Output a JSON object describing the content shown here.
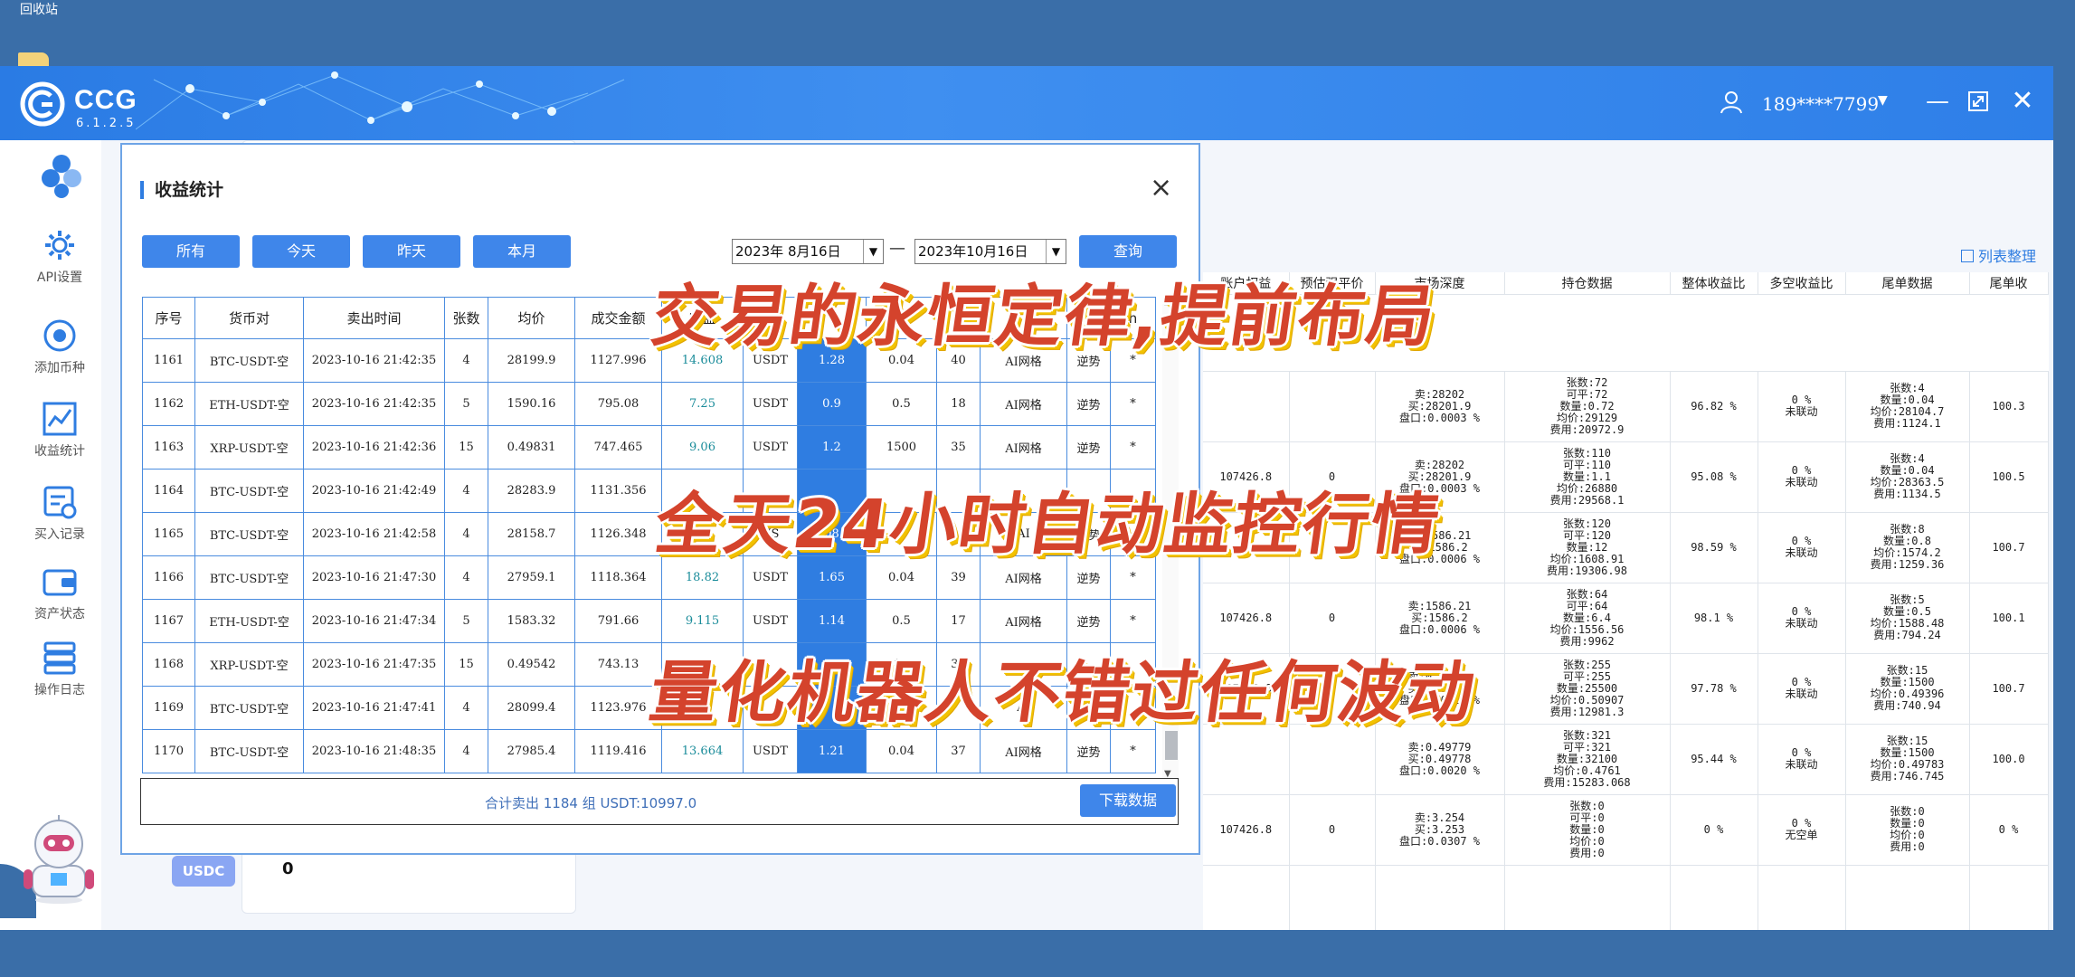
{
  "desktop": {
    "recycle_bin": "回收站"
  },
  "header": {
    "app_name": "CCG",
    "version": "6.1.2.5",
    "user": "189****7799"
  },
  "sidebar": {
    "items": [
      {
        "label": "API设置",
        "icon": "gear-icon"
      },
      {
        "label": "添加币种",
        "icon": "coin-add-icon"
      },
      {
        "label": "收益统计",
        "icon": "chart-icon"
      },
      {
        "label": "买入记录",
        "icon": "record-icon"
      },
      {
        "label": "资产状态",
        "icon": "wallet-icon"
      },
      {
        "label": "操作日志",
        "icon": "log-icon"
      }
    ]
  },
  "background": {
    "usdc_label": "USDC",
    "usdc_value": "0",
    "list_sort": "列表整理",
    "columns": [
      "账户权益",
      "预估强平价",
      "市场深度",
      "持仓数据",
      "整体收益比",
      "多空收益比",
      "尾单数据",
      "尾单收"
    ],
    "rows": [
      {
        "equity": "",
        "liq": "",
        "depth": [
          "卖:28202",
          "买:28201.9",
          "盘口:0.0003 %"
        ],
        "position": [
          "张数:72",
          "可平:72",
          "数量:0.72",
          "均价:29129",
          "费用:20972.9"
        ],
        "overall": "96.82 %",
        "ls": [
          "0 %",
          "未联动"
        ],
        "tail": [
          "张数:4",
          "数量:0.04",
          "均价:28104.7",
          "费用:1124.1"
        ],
        "tail_ret": "100.3"
      },
      {
        "equity": "107426.8",
        "liq": "0",
        "depth": [
          "卖:28202",
          "买:28201.9",
          "盘口:0.0003 %"
        ],
        "position": [
          "张数:110",
          "可平:110",
          "数量:1.1",
          "均价:26880",
          "费用:29568.1"
        ],
        "overall": "95.08 %",
        "ls": [
          "0 %",
          "未联动"
        ],
        "tail": [
          "张数:4",
          "数量:0.04",
          "均价:28363.5",
          "费用:1134.5"
        ],
        "tail_ret": "100.5"
      },
      {
        "equity": "",
        "liq": "",
        "depth": [
          "卖:1586.21",
          "买:1586.2",
          "盘口:0.0006 %"
        ],
        "position": [
          "张数:120",
          "可平:120",
          "数量:12",
          "均价:1608.91",
          "费用:19306.98"
        ],
        "overall": "98.59 %",
        "ls": [
          "0 %",
          "未联动"
        ],
        "tail": [
          "张数:8",
          "数量:0.8",
          "均价:1574.2",
          "费用:1259.36"
        ],
        "tail_ret": "100.7"
      },
      {
        "equity": "107426.8",
        "liq": "0",
        "depth": [
          "卖:1586.21",
          "买:1586.2",
          "盘口:0.0006 %"
        ],
        "position": [
          "张数:64",
          "可平:64",
          "数量:6.4",
          "均价:1556.56",
          "费用:9962"
        ],
        "overall": "98.1 %",
        "ls": [
          "0 %",
          "未联动"
        ],
        "tail": [
          "张数:5",
          "数量:0.5",
          "均价:1588.48",
          "费用:794.24"
        ],
        "tail_ret": "100.1"
      },
      {
        "equity": "107426.8",
        "liq": "0",
        "depth": [
          "卖:0.49779",
          "买:0.49778",
          "盘口:0.0020 %"
        ],
        "position": [
          "张数:255",
          "可平:255",
          "数量:25500",
          "均价:0.50907",
          "费用:12981.3"
        ],
        "overall": "97.78 %",
        "ls": [
          "0 %",
          "未联动"
        ],
        "tail": [
          "张数:15",
          "数量:1500",
          "均价:0.49396",
          "费用:740.94"
        ],
        "tail_ret": "100.7"
      },
      {
        "equity": "",
        "liq": "",
        "depth": [
          "卖:0.49779",
          "买:0.49778",
          "盘口:0.0020 %"
        ],
        "position": [
          "张数:321",
          "可平:321",
          "数量:32100",
          "均价:0.4761",
          "费用:15283.068"
        ],
        "overall": "95.44 %",
        "ls": [
          "0 %",
          "未联动"
        ],
        "tail": [
          "张数:15",
          "数量:1500",
          "均价:0.49783",
          "费用:746.745"
        ],
        "tail_ret": "100.0"
      },
      {
        "equity": "107426.8",
        "liq": "0",
        "depth": [
          "卖:3.254",
          "买:3.253",
          "盘口:0.0307 %"
        ],
        "position": [
          "张数:0",
          "可平:0",
          "数量:0",
          "均价:0",
          "费用:0"
        ],
        "overall": "0 %",
        "ls": [
          "0 %",
          "无空单"
        ],
        "tail": [
          "张数:0",
          "数量:0",
          "均价:0",
          "费用:0"
        ],
        "tail_ret": "0 %"
      }
    ]
  },
  "dialog": {
    "title": "收益统计",
    "buttons": [
      "所有",
      "今天",
      "昨天",
      "本月"
    ],
    "date_from": "2023年 8月16日",
    "date_to": "2023年10月16日",
    "query": "查询",
    "columns": [
      "序号",
      "货币对",
      "卖出时间",
      "张数",
      "均价",
      "成交金额",
      "收益",
      "",
      "",
      "",
      "",
      "",
      "",
      "h"
    ],
    "rows": [
      [
        "1161",
        "BTC-USDT-空",
        "2023-10-16 21:42:35",
        "4",
        "28199.9",
        "1127.996",
        "14.608",
        "USDT",
        "1.28",
        "0.04",
        "40",
        "AI网格",
        "逆势",
        "*"
      ],
      [
        "1162",
        "ETH-USDT-空",
        "2023-10-16 21:42:35",
        "5",
        "1590.16",
        "795.08",
        "7.25",
        "USDT",
        "0.9",
        "0.5",
        "18",
        "AI网格",
        "逆势",
        "*"
      ],
      [
        "1163",
        "XRP-USDT-空",
        "2023-10-16 21:42:36",
        "15",
        "0.49831",
        "747.465",
        "9.06",
        "USDT",
        "1.2",
        "1500",
        "35",
        "AI网格",
        "逆势",
        "*"
      ],
      [
        "1164",
        "BTC-USDT-空",
        "2023-10-16 21:42:49",
        "4",
        "28283.9",
        "1131.356",
        "",
        "",
        "",
        "",
        "",
        "",
        "",
        ""
      ],
      [
        "1165",
        "BTC-USDT-空",
        "2023-10-16 21:42:58",
        "4",
        "28158.7",
        "1126.348",
        "",
        "US",
        "08",
        "0",
        "",
        "AI",
        "逆势",
        ""
      ],
      [
        "1166",
        "BTC-USDT-空",
        "2023-10-16 21:47:30",
        "4",
        "27959.1",
        "1118.364",
        "18.82",
        "USDT",
        "1.65",
        "0.04",
        "39",
        "AI网格",
        "逆势",
        "*"
      ],
      [
        "1167",
        "ETH-USDT-空",
        "2023-10-16 21:47:34",
        "5",
        "1583.32",
        "791.66",
        "9.115",
        "USDT",
        "1.14",
        "0.5",
        "17",
        "AI网格",
        "逆势",
        "*"
      ],
      [
        "1168",
        "XRP-USDT-空",
        "2023-10-16 21:47:35",
        "15",
        "0.49542",
        "743.13",
        "5",
        "",
        "",
        "00",
        "34",
        "",
        "",
        ""
      ],
      [
        "1169",
        "BTC-USDT-空",
        "2023-10-16 21:47:41",
        "4",
        "28099.4",
        "1123.976",
        "06",
        "",
        "",
        "",
        "",
        "AI",
        "",
        ""
      ],
      [
        "1170",
        "BTC-USDT-空",
        "2023-10-16 21:48:35",
        "4",
        "27985.4",
        "1119.416",
        "13.664",
        "USDT",
        "1.21",
        "0.04",
        "37",
        "AI网格",
        "逆势",
        "*"
      ]
    ],
    "summary": "合计卖出 1184 组    USDT:10997.0",
    "download": "下载数据"
  },
  "overlays": {
    "line1": "交易的永恒定律,提前布局",
    "line2": "全天24小时自动监控行情",
    "line3": "量化机器人不错过任何波动"
  },
  "colors": {
    "accent": "#2f7de1",
    "overlay_text": "#d4432c",
    "overlay_shadow": "#f2c200"
  }
}
